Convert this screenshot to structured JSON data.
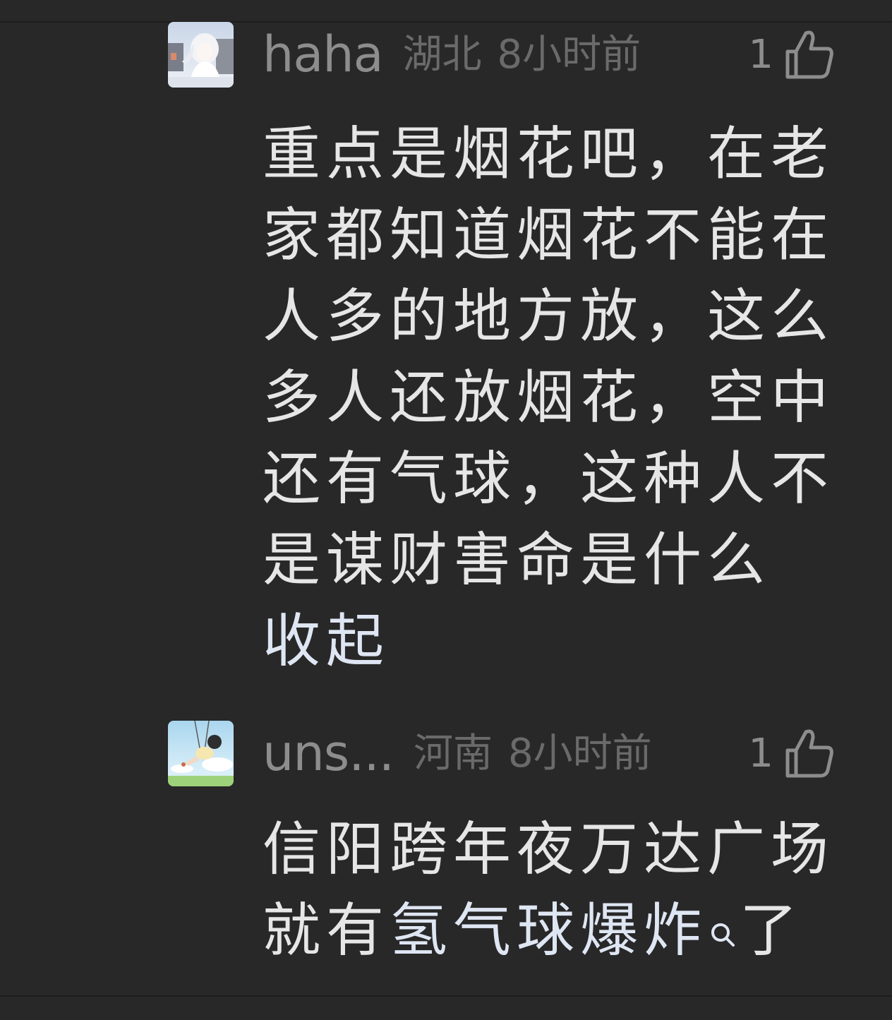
{
  "comments": [
    {
      "username": "haha",
      "location": "湖北",
      "time": "8小时前",
      "likes": "1",
      "avatar": "anime-girl-avatar",
      "text": "重点是烟花吧，在老家都知道烟花不能在人多的地方放，这么多人还放烟花，空中还有气球，这种人不是谋财害命是什么",
      "collapse_label": "收起"
    },
    {
      "username": "uns...",
      "location": "河南",
      "time": "8小时前",
      "likes": "1",
      "avatar": "swing-girl-avatar",
      "text_before": "信阳跨年夜万达广场就有",
      "text_link": "氢气球爆炸",
      "text_after": "了"
    }
  ],
  "colors": {
    "background": "#282828",
    "meta_text": "#8d8d8d",
    "body_text": "#e6e6e6",
    "link_text": "#dfe6f3"
  }
}
